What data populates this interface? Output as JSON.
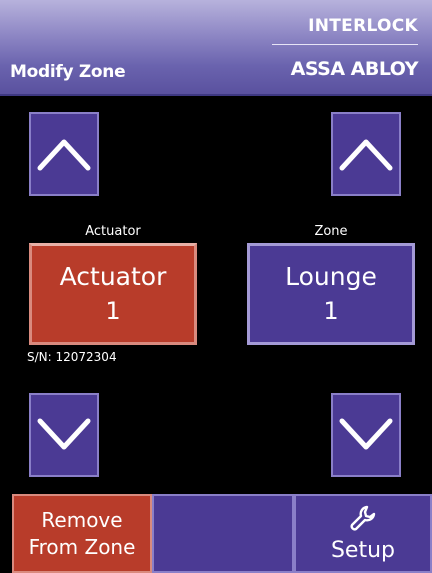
{
  "header": {
    "title": "Modify Zone",
    "brand_top": "INTERLOCK",
    "brand_bottom": "ASSA ABLOY"
  },
  "actuator": {
    "label": "Actuator",
    "tile_line1": "Actuator",
    "tile_line2": "1",
    "serial": "S/N: 12072304",
    "up_icon": "chevron-up-icon",
    "down_icon": "chevron-down-icon"
  },
  "zone": {
    "label": "Zone",
    "tile_line1": "Lounge",
    "tile_line2": "1",
    "up_icon": "chevron-up-icon",
    "down_icon": "chevron-down-icon"
  },
  "bottom_bar": {
    "remove_line1": "Remove",
    "remove_line2": "From Zone",
    "setup_label": "Setup",
    "setup_icon": "wrench-icon"
  },
  "colors": {
    "header_top": "#b7b2dc",
    "header_bottom": "#5a519f",
    "purple_button": "#4b3a94",
    "red_button": "#b83c2a",
    "background": "#000000"
  }
}
